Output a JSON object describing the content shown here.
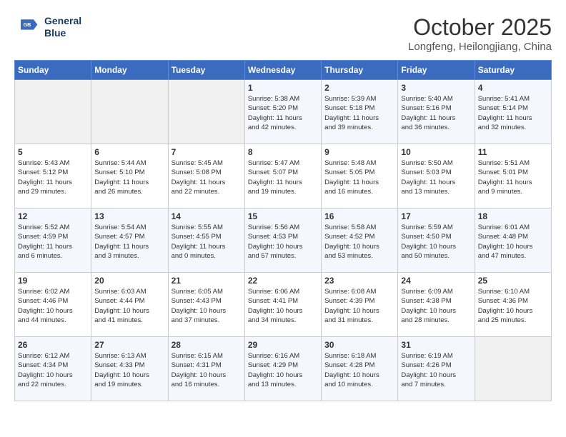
{
  "header": {
    "logo_line1": "General",
    "logo_line2": "Blue",
    "month": "October 2025",
    "location": "Longfeng, Heilongjiang, China"
  },
  "weekdays": [
    "Sunday",
    "Monday",
    "Tuesday",
    "Wednesday",
    "Thursday",
    "Friday",
    "Saturday"
  ],
  "weeks": [
    [
      {
        "day": "",
        "info": ""
      },
      {
        "day": "",
        "info": ""
      },
      {
        "day": "",
        "info": ""
      },
      {
        "day": "1",
        "info": "Sunrise: 5:38 AM\nSunset: 5:20 PM\nDaylight: 11 hours\nand 42 minutes."
      },
      {
        "day": "2",
        "info": "Sunrise: 5:39 AM\nSunset: 5:18 PM\nDaylight: 11 hours\nand 39 minutes."
      },
      {
        "day": "3",
        "info": "Sunrise: 5:40 AM\nSunset: 5:16 PM\nDaylight: 11 hours\nand 36 minutes."
      },
      {
        "day": "4",
        "info": "Sunrise: 5:41 AM\nSunset: 5:14 PM\nDaylight: 11 hours\nand 32 minutes."
      }
    ],
    [
      {
        "day": "5",
        "info": "Sunrise: 5:43 AM\nSunset: 5:12 PM\nDaylight: 11 hours\nand 29 minutes."
      },
      {
        "day": "6",
        "info": "Sunrise: 5:44 AM\nSunset: 5:10 PM\nDaylight: 11 hours\nand 26 minutes."
      },
      {
        "day": "7",
        "info": "Sunrise: 5:45 AM\nSunset: 5:08 PM\nDaylight: 11 hours\nand 22 minutes."
      },
      {
        "day": "8",
        "info": "Sunrise: 5:47 AM\nSunset: 5:07 PM\nDaylight: 11 hours\nand 19 minutes."
      },
      {
        "day": "9",
        "info": "Sunrise: 5:48 AM\nSunset: 5:05 PM\nDaylight: 11 hours\nand 16 minutes."
      },
      {
        "day": "10",
        "info": "Sunrise: 5:50 AM\nSunset: 5:03 PM\nDaylight: 11 hours\nand 13 minutes."
      },
      {
        "day": "11",
        "info": "Sunrise: 5:51 AM\nSunset: 5:01 PM\nDaylight: 11 hours\nand 9 minutes."
      }
    ],
    [
      {
        "day": "12",
        "info": "Sunrise: 5:52 AM\nSunset: 4:59 PM\nDaylight: 11 hours\nand 6 minutes."
      },
      {
        "day": "13",
        "info": "Sunrise: 5:54 AM\nSunset: 4:57 PM\nDaylight: 11 hours\nand 3 minutes."
      },
      {
        "day": "14",
        "info": "Sunrise: 5:55 AM\nSunset: 4:55 PM\nDaylight: 11 hours\nand 0 minutes."
      },
      {
        "day": "15",
        "info": "Sunrise: 5:56 AM\nSunset: 4:53 PM\nDaylight: 10 hours\nand 57 minutes."
      },
      {
        "day": "16",
        "info": "Sunrise: 5:58 AM\nSunset: 4:52 PM\nDaylight: 10 hours\nand 53 minutes."
      },
      {
        "day": "17",
        "info": "Sunrise: 5:59 AM\nSunset: 4:50 PM\nDaylight: 10 hours\nand 50 minutes."
      },
      {
        "day": "18",
        "info": "Sunrise: 6:01 AM\nSunset: 4:48 PM\nDaylight: 10 hours\nand 47 minutes."
      }
    ],
    [
      {
        "day": "19",
        "info": "Sunrise: 6:02 AM\nSunset: 4:46 PM\nDaylight: 10 hours\nand 44 minutes."
      },
      {
        "day": "20",
        "info": "Sunrise: 6:03 AM\nSunset: 4:44 PM\nDaylight: 10 hours\nand 41 minutes."
      },
      {
        "day": "21",
        "info": "Sunrise: 6:05 AM\nSunset: 4:43 PM\nDaylight: 10 hours\nand 37 minutes."
      },
      {
        "day": "22",
        "info": "Sunrise: 6:06 AM\nSunset: 4:41 PM\nDaylight: 10 hours\nand 34 minutes."
      },
      {
        "day": "23",
        "info": "Sunrise: 6:08 AM\nSunset: 4:39 PM\nDaylight: 10 hours\nand 31 minutes."
      },
      {
        "day": "24",
        "info": "Sunrise: 6:09 AM\nSunset: 4:38 PM\nDaylight: 10 hours\nand 28 minutes."
      },
      {
        "day": "25",
        "info": "Sunrise: 6:10 AM\nSunset: 4:36 PM\nDaylight: 10 hours\nand 25 minutes."
      }
    ],
    [
      {
        "day": "26",
        "info": "Sunrise: 6:12 AM\nSunset: 4:34 PM\nDaylight: 10 hours\nand 22 minutes."
      },
      {
        "day": "27",
        "info": "Sunrise: 6:13 AM\nSunset: 4:33 PM\nDaylight: 10 hours\nand 19 minutes."
      },
      {
        "day": "28",
        "info": "Sunrise: 6:15 AM\nSunset: 4:31 PM\nDaylight: 10 hours\nand 16 minutes."
      },
      {
        "day": "29",
        "info": "Sunrise: 6:16 AM\nSunset: 4:29 PM\nDaylight: 10 hours\nand 13 minutes."
      },
      {
        "day": "30",
        "info": "Sunrise: 6:18 AM\nSunset: 4:28 PM\nDaylight: 10 hours\nand 10 minutes."
      },
      {
        "day": "31",
        "info": "Sunrise: 6:19 AM\nSunset: 4:26 PM\nDaylight: 10 hours\nand 7 minutes."
      },
      {
        "day": "",
        "info": ""
      }
    ]
  ]
}
